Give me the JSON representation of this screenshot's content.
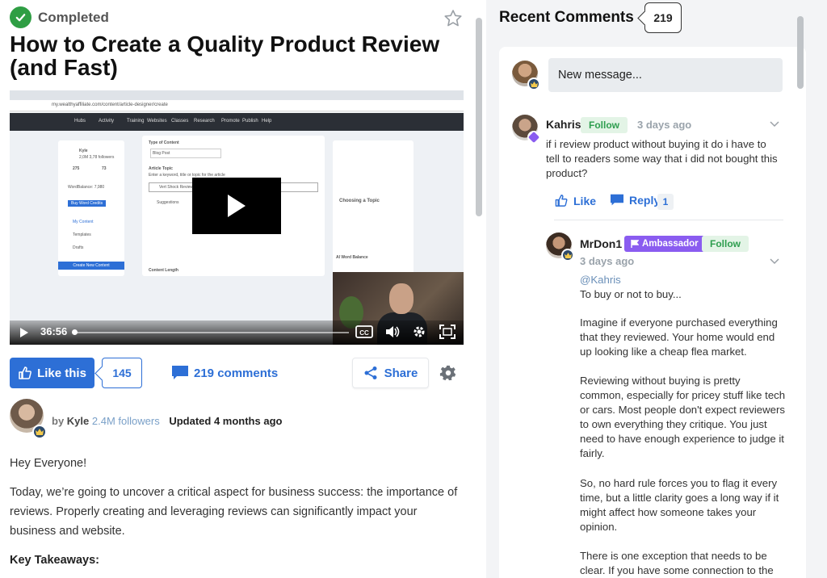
{
  "article": {
    "status": "Completed",
    "title": "How to Create a Quality Product Review (and Fast)",
    "video": {
      "duration": "36:56",
      "screenshot_url": "my.wealthyaffiliate.com/content/article-designer/create",
      "nav": [
        "Hubs",
        "Activity",
        "Training",
        "Websites",
        "Classes",
        "Research",
        "Promote",
        "Publish",
        "Help"
      ],
      "sidebar": {
        "user": "Kyle",
        "followers": "2,0M 3,78 followers",
        "stat1": "275",
        "stat2": "73",
        "word_balance": "WordBalance: 7,980",
        "my_content": "My Content",
        "templates": "Templates",
        "drafts": "Drafts",
        "create_btn": "Create New Content",
        "buy_credits": "Buy Word Credits"
      },
      "form": {
        "type_label": "Type of Content",
        "type_value": "Blog Post",
        "topic_label": "Article Topic",
        "topic_hint": "Enter a keyword, title or topic for the article",
        "topic_value": "Vert Shock Review",
        "suggestions": "Suggestions",
        "length_label": "Content Length"
      },
      "side_card": {
        "title": "Choosing a Topic",
        "ai_title": "AI Word Balance"
      }
    },
    "likes": {
      "label": "Like this",
      "count": "145"
    },
    "comments_label": "219 comments",
    "share_label": "Share",
    "author": {
      "by": "by",
      "name": "Kyle",
      "followers": "2.4M followers",
      "updated": "Updated 4 months ago"
    },
    "body": [
      "Hey Everyone!",
      "Today, we’re going to uncover a critical aspect for business success: the importance of reviews. Properly creating and leveraging reviews can significantly impact your business and website."
    ],
    "key_takeaways": "Key Takeaways:"
  },
  "comments": {
    "title": "Recent Comments",
    "count": "219",
    "new_message_placeholder": "New message...",
    "items": [
      {
        "name": "Kahris",
        "follow": "Follow",
        "time": "3 days ago",
        "text": "if i review product without buying it do i have to tell to readers some way that i did not bought this product?",
        "like": "Like",
        "reply": "Reply",
        "reply_count": "1"
      },
      {
        "name": "MrDon1",
        "badge": "Ambassador",
        "follow": "Follow",
        "time": "3 days ago",
        "mention": "@Kahris",
        "paragraphs": [
          "To buy or not to buy...",
          "Imagine if everyone purchased everything that they reviewed. Your home would end up looking like a cheap flea market.",
          "Reviewing without buying is pretty common, especially for pricey stuff like tech or cars. Most people don't expect reviewers to own everything they critique. You just need to have enough experience to judge it fairly.",
          "So, no hard rule forces you to flag it every time, but a little clarity goes a long way if it might affect how someone takes your opinion.",
          "There is one exception that needs to be clear. If you have some connection to the"
        ]
      }
    ]
  },
  "colors": {
    "primary": "#2d6fd6",
    "success": "#2f9e44",
    "follow_bg": "#e3f4e6",
    "ambassador": "#8a5cf0"
  }
}
